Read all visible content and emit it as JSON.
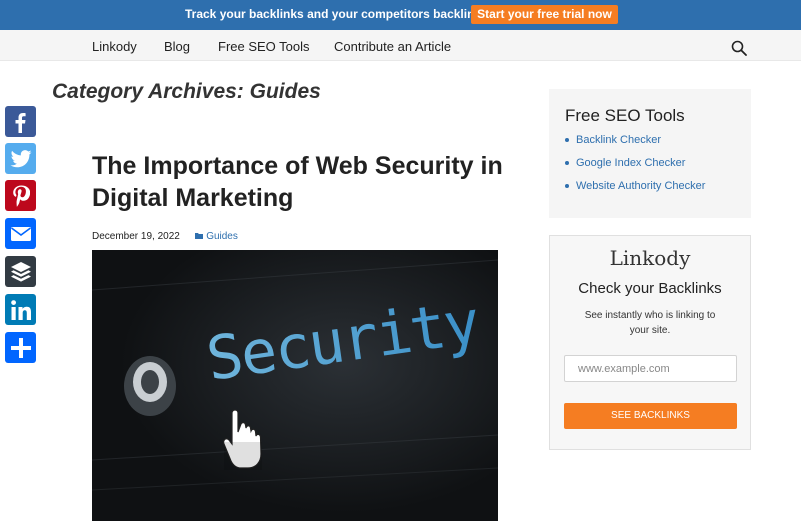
{
  "promo": {
    "text": "Track your backlinks and your competitors backlinks",
    "cta_label": "Start your free trial now",
    "bar_color": "#2e6fae",
    "cta_color": "#f57d22"
  },
  "nav": {
    "items": [
      {
        "label": "Linkody"
      },
      {
        "label": "Blog"
      },
      {
        "label": "Free SEO Tools"
      },
      {
        "label": "Contribute an Article"
      }
    ],
    "search_icon": "search-icon"
  },
  "social": {
    "buttons": [
      {
        "name": "facebook",
        "icon": "facebook-icon",
        "color": "#3b5998"
      },
      {
        "name": "twitter",
        "icon": "twitter-icon",
        "color": "#55acee"
      },
      {
        "name": "pinterest",
        "icon": "pinterest-icon",
        "color": "#bd081c"
      },
      {
        "name": "email",
        "icon": "email-icon",
        "color": "#0166ff"
      },
      {
        "name": "buffer",
        "icon": "buffer-icon",
        "color": "#323b43"
      },
      {
        "name": "linkedin",
        "icon": "linkedin-icon",
        "color": "#007bb5"
      },
      {
        "name": "share",
        "icon": "share-plus-icon",
        "color": "#0166ff"
      }
    ]
  },
  "main": {
    "archive_title": "Category Archives: Guides",
    "post": {
      "title": "The Importance of Web Security in Digital Marketing",
      "date": "December 19, 2022",
      "category": "Guides",
      "image_text": "Security"
    }
  },
  "sidebar": {
    "tools": {
      "title": "Free SEO Tools",
      "links": [
        {
          "label": "Backlink Checker"
        },
        {
          "label": "Google Index Checker"
        },
        {
          "label": "Website Authority Checker"
        }
      ]
    },
    "check": {
      "brand": "Linkody",
      "title": "Check your Backlinks",
      "description": "See instantly who is linking to your site.",
      "input_placeholder": "www.example.com",
      "button_label": "SEE BACKLINKS"
    }
  }
}
